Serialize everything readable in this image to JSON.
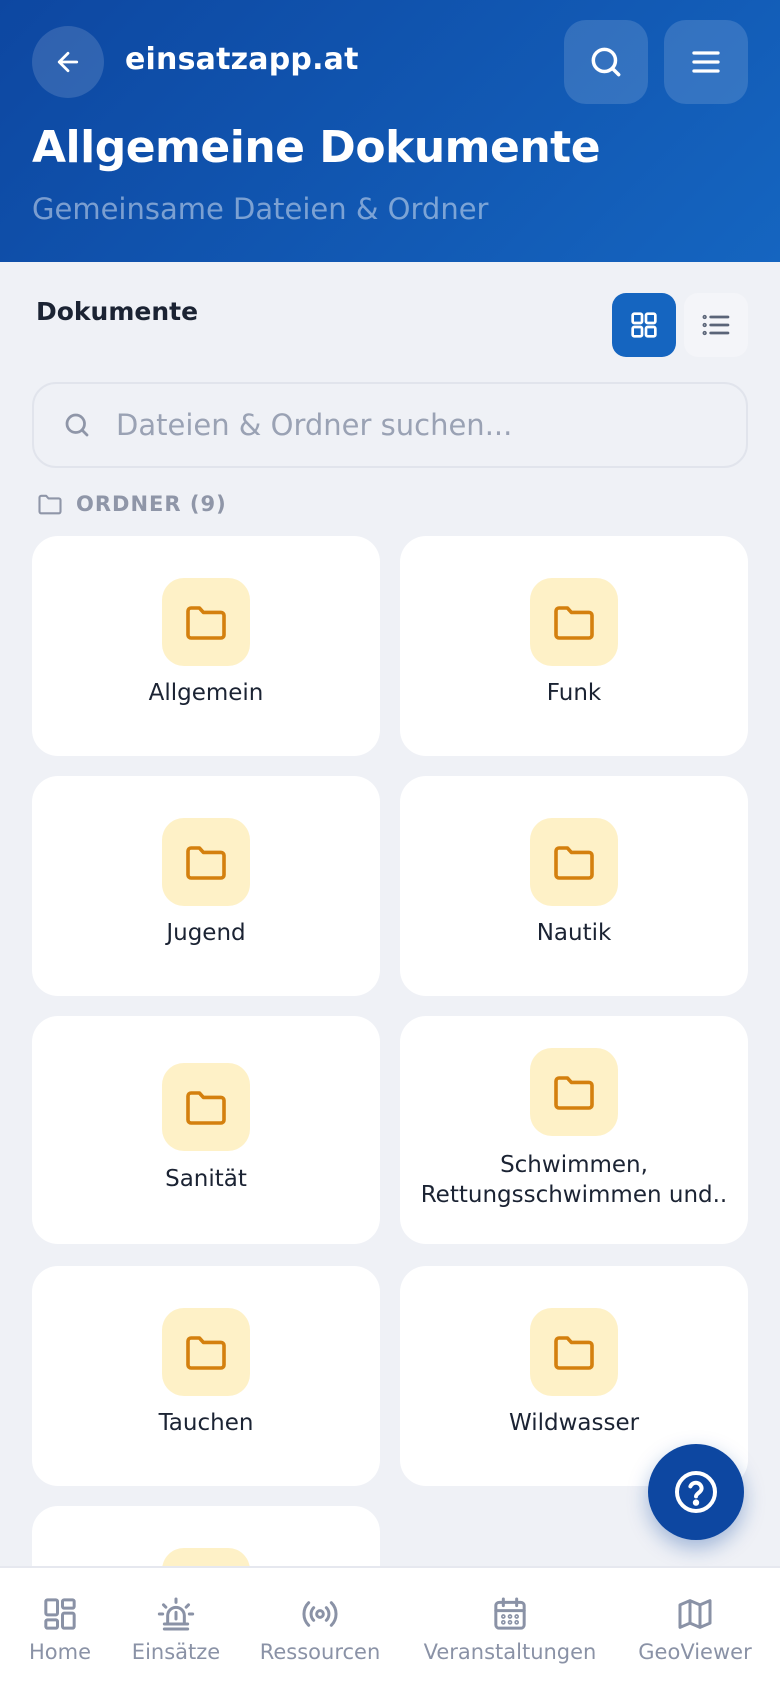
{
  "header": {
    "brand": "einsatzapp.at",
    "title": "Allgemeine Dokumente",
    "subtitle": "Gemeinsame Dateien & Ordner",
    "icons": {
      "back": "arrow-left-icon",
      "search": "search-icon",
      "menu": "menu-icon"
    }
  },
  "section": {
    "title": "Dokumente",
    "view_modes": [
      "grid",
      "list"
    ],
    "active_view": "grid"
  },
  "search": {
    "placeholder": "Dateien & Ordner suchen...",
    "value": ""
  },
  "folders": {
    "label": "ORDNER (9)",
    "items": [
      {
        "name": "Allgemein"
      },
      {
        "name": "Funk"
      },
      {
        "name": "Jugend"
      },
      {
        "name": "Nautik"
      },
      {
        "name": "Sanität"
      },
      {
        "name": "Schwimmen, Rettungsschwimmen und.."
      },
      {
        "name": "Tauchen"
      },
      {
        "name": "Wildwasser"
      },
      {
        "name": ""
      }
    ]
  },
  "bottom_nav": {
    "items": [
      {
        "label": "Home",
        "icon": "home-icon"
      },
      {
        "label": "Einsätze",
        "icon": "siren-icon"
      },
      {
        "label": "Ressourcen",
        "icon": "radio-icon"
      },
      {
        "label": "Veranstaltungen",
        "icon": "calendar-icon"
      },
      {
        "label": "GeoViewer",
        "icon": "map-icon"
      }
    ]
  },
  "colors": {
    "header_bg": "#1155b5",
    "accent": "#1565c0",
    "folder_icon_bg": "#fef1c7",
    "folder_icon_stroke": "#d4800e",
    "page_bg": "#eff1f6"
  }
}
